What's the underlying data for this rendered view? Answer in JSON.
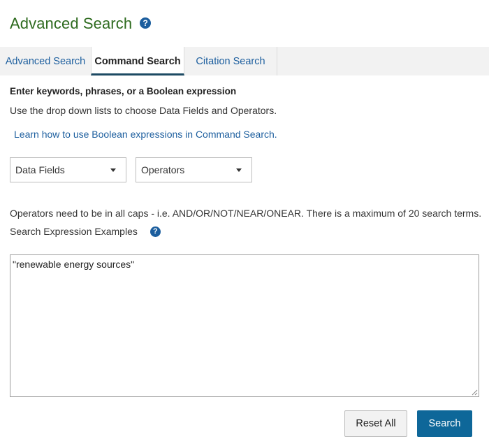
{
  "header": {
    "title": "Advanced Search",
    "help_icon": "question-circle-icon"
  },
  "tabs": [
    {
      "label": "Advanced Search",
      "active": false
    },
    {
      "label": "Command Search",
      "active": true
    },
    {
      "label": "Citation Search",
      "active": false
    }
  ],
  "command": {
    "heading": "Enter keywords, phrases, or a Boolean expression",
    "instructions": "Use the drop down lists to choose Data Fields and Operators.",
    "learn_link": "Learn how to use Boolean expressions in Command Search."
  },
  "dropdowns": {
    "data_fields": {
      "selected": "Data Fields",
      "icon": "caret-down-icon"
    },
    "operators": {
      "selected": "Operators",
      "icon": "caret-down-icon"
    }
  },
  "info": {
    "operators_note": "Operators need to be in all caps - i.e. AND/OR/NOT/NEAR/ONEAR. There is a maximum of 20 search terms.",
    "examples_label": "Search Expression Examples",
    "examples_icon": "question-circle-icon"
  },
  "expression": {
    "value": "\"renewable energy sources\""
  },
  "buttons": {
    "reset_label": "Reset All",
    "search_label": "Search"
  },
  "colors": {
    "title_green": "#2e6b1f",
    "link_blue": "#1c5e9e",
    "primary_button": "#0e6799",
    "active_tab_underline": "#1d4a63"
  }
}
